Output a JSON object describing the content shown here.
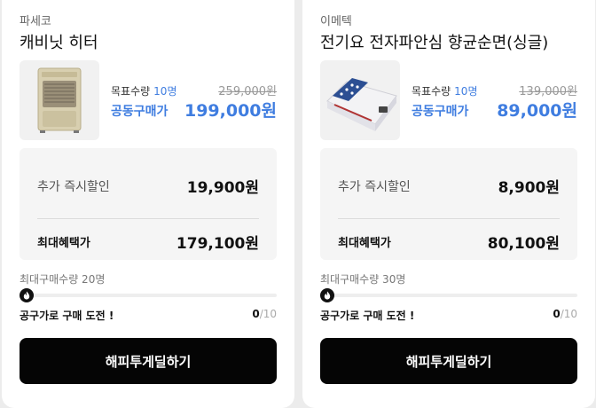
{
  "products": [
    {
      "brand": "파세코",
      "name": "캐비닛 히터",
      "image_icon": "heater-icon",
      "goal_label": "목표수량",
      "goal_count": "10명",
      "original_price": "259,000원",
      "group_label": "공동구매가",
      "group_price": "199,000원",
      "extra_label": "추가 즉시할인",
      "extra_value": "19,900원",
      "max_benefit_label": "최대혜택가",
      "max_benefit_value": "179,100원",
      "max_qty": "최대구매수량 20명",
      "progress_fraction": 0,
      "challenge": "공구가로 구매 도전 !",
      "progress_current": "0",
      "progress_total": "/10",
      "cta": "해피투게딜하기"
    },
    {
      "brand": "이메텍",
      "name": "전기요 전자파안심 향균순면(싱글)",
      "image_icon": "electric-blanket-icon",
      "goal_label": "목표수량",
      "goal_count": "10명",
      "original_price": "139,000원",
      "group_label": "공동구매가",
      "group_price": "89,000원",
      "extra_label": "추가 즉시할인",
      "extra_value": "8,900원",
      "max_benefit_label": "최대혜택가",
      "max_benefit_value": "80,100원",
      "max_qty": "최대구매수량 30명",
      "progress_fraction": 0,
      "challenge": "공구가로 구매 도전 !",
      "progress_current": "0",
      "progress_total": "/10",
      "cta": "해피투게딜하기"
    }
  ],
  "colors": {
    "accent": "#3f7de0",
    "button": "#050505",
    "panel": "#f5f5f5",
    "background": "#ececec"
  }
}
